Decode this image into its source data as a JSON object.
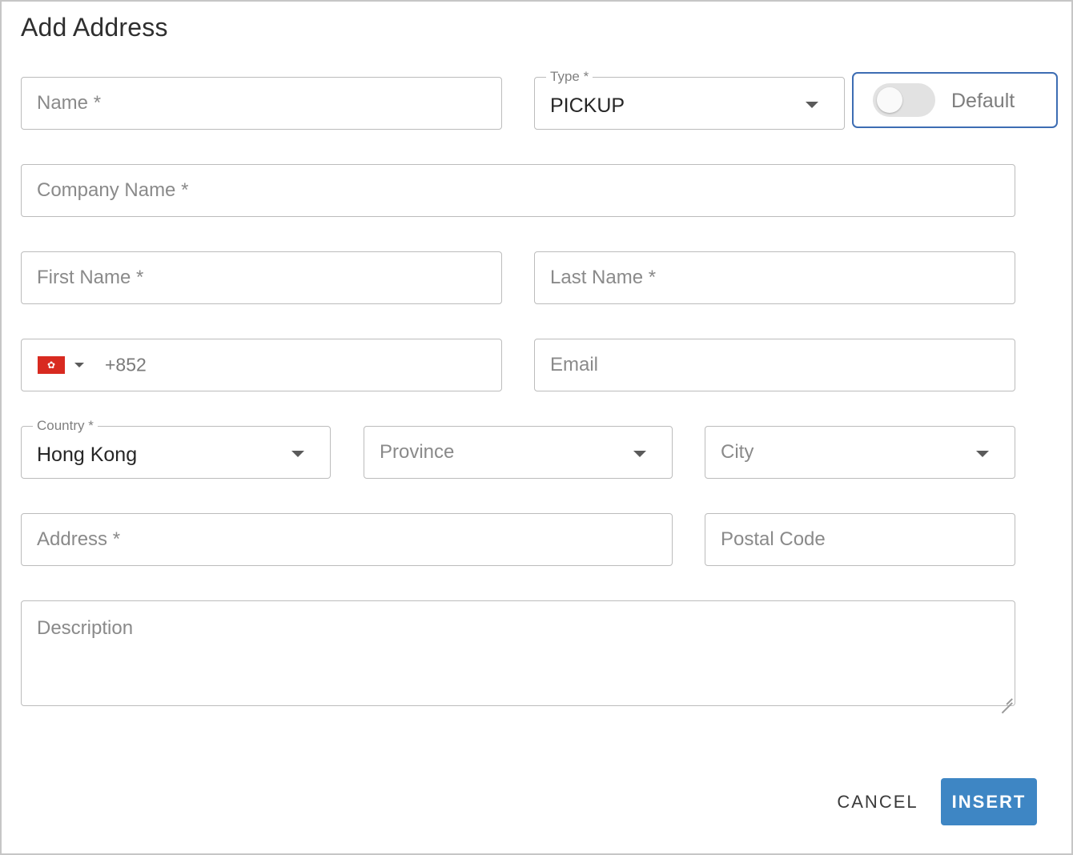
{
  "dialog": {
    "title": "Add Address"
  },
  "fields": {
    "name": {
      "placeholder": "Name *"
    },
    "type": {
      "label": "Type *",
      "value": "PICKUP"
    },
    "default_toggle": {
      "label": "Default",
      "checked": false
    },
    "company_name": {
      "placeholder": "Company Name *"
    },
    "first_name": {
      "placeholder": "First Name *"
    },
    "last_name": {
      "placeholder": "Last Name *"
    },
    "phone": {
      "flag_icon": "hong-kong-flag-icon",
      "code": "+852"
    },
    "email": {
      "placeholder": "Email"
    },
    "country": {
      "label": "Country *",
      "value": "Hong Kong"
    },
    "province": {
      "placeholder": "Province"
    },
    "city": {
      "placeholder": "City"
    },
    "address": {
      "placeholder": "Address *"
    },
    "postal_code": {
      "placeholder": "Postal Code"
    },
    "description": {
      "placeholder": "Description"
    }
  },
  "actions": {
    "cancel_label": "CANCEL",
    "insert_label": "INSERT"
  },
  "colors": {
    "primary": "#3e86c4",
    "focus_outline": "#3d6db3",
    "flag_red": "#d82a20"
  }
}
